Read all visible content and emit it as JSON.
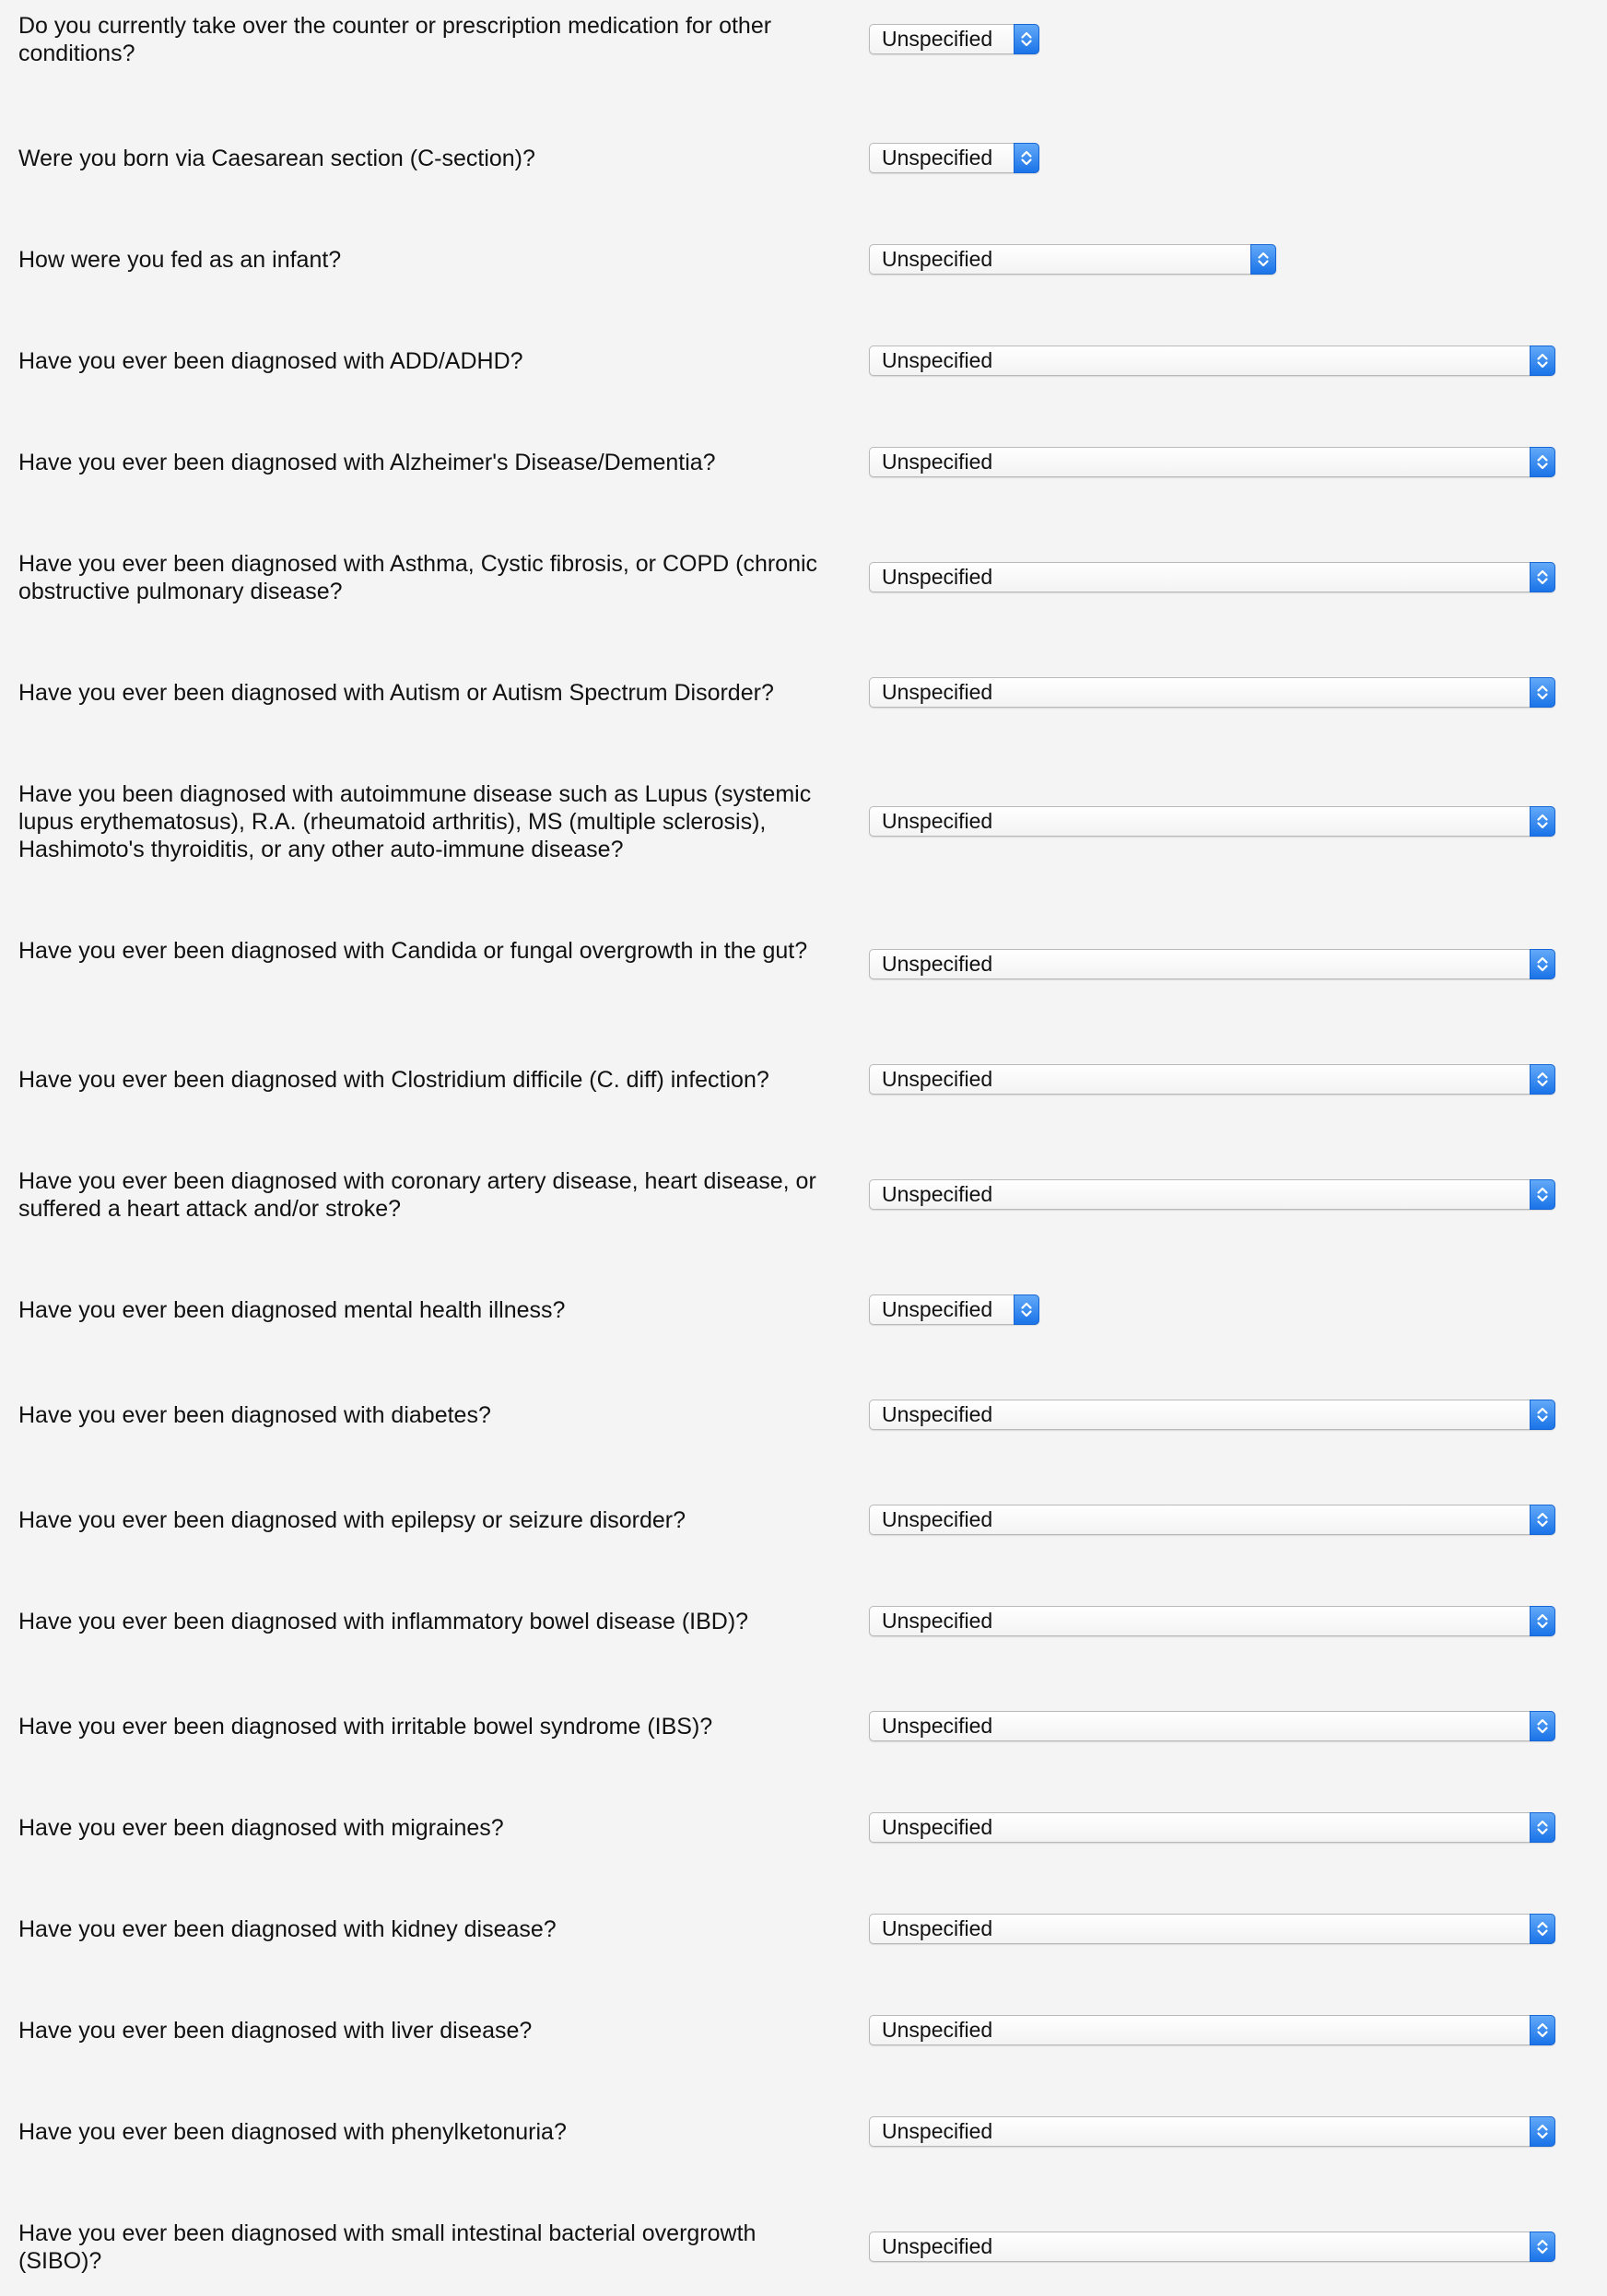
{
  "questions": [
    {
      "text": "Do you currently take over the counter or prescription medication for other conditions?",
      "value": "Unspecified"
    },
    {
      "text": "Were you born via Caesarean section (C-section)?",
      "value": "Unspecified"
    },
    {
      "text": "How were you fed as an infant?",
      "value": "Unspecified"
    },
    {
      "text": "Have you ever been diagnosed with ADD/ADHD?",
      "value": "Unspecified"
    },
    {
      "text": "Have you ever been diagnosed with Alzheimer's Disease/Dementia?",
      "value": "Unspecified"
    },
    {
      "text": "Have you ever been diagnosed with Asthma, Cystic fibrosis, or COPD (chronic obstructive pulmonary disease?",
      "value": "Unspecified"
    },
    {
      "text": "Have you ever been diagnosed with Autism or Autism Spectrum Disorder?",
      "value": "Unspecified"
    },
    {
      "text": "Have you been diagnosed with autoimmune disease such as Lupus (systemic lupus erythematosus), R.A. (rheumatoid arthritis), MS (multiple sclerosis), Hashimoto's thyroiditis, or any other auto-immune disease?",
      "value": "Unspecified"
    },
    {
      "text": "Have you ever been diagnosed with Candida or fungal overgrowth in the gut?",
      "value": "Unspecified"
    },
    {
      "text": "Have you ever been diagnosed with Clostridium difficile (C. diff) infection?",
      "value": "Unspecified"
    },
    {
      "text": "Have you ever been diagnosed with coronary artery disease, heart disease, or suffered a heart attack and/or stroke?",
      "value": "Unspecified"
    },
    {
      "text": "Have you ever been diagnosed mental health illness?",
      "value": "Unspecified"
    },
    {
      "text": "Have you ever been diagnosed with diabetes?",
      "value": "Unspecified"
    },
    {
      "text": "Have you ever been diagnosed with epilepsy or seizure disorder?",
      "value": "Unspecified"
    },
    {
      "text": "Have you ever been diagnosed with inflammatory bowel disease (IBD)?",
      "value": "Unspecified"
    },
    {
      "text": "Have you ever been diagnosed with irritable bowel syndrome (IBS)?",
      "value": "Unspecified"
    },
    {
      "text": "Have you ever been diagnosed with migraines?",
      "value": "Unspecified"
    },
    {
      "text": "Have you ever been diagnosed with kidney disease?",
      "value": "Unspecified"
    },
    {
      "text": "Have you ever been diagnosed with liver disease?",
      "value": "Unspecified"
    },
    {
      "text": "Have you ever been diagnosed with phenylketonuria?",
      "value": "Unspecified"
    },
    {
      "text": "Have you ever been diagnosed with small intestinal bacterial overgrowth (SIBO)?",
      "value": "Unspecified"
    }
  ],
  "colors": {
    "page_background": "#f4f4f4",
    "select_accent": "#1a73e8"
  },
  "icons": {
    "select_chevron": "chevron-up-down-icon"
  }
}
